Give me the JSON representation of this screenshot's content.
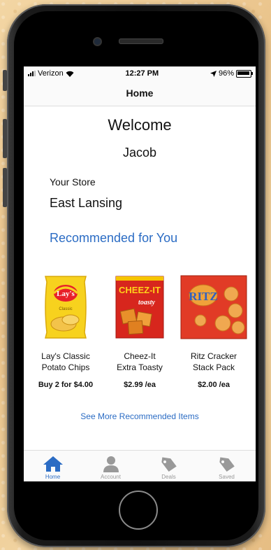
{
  "status_bar": {
    "carrier": "Verizon",
    "time": "12:27 PM",
    "battery": "96%"
  },
  "nav": {
    "title": "Home"
  },
  "home": {
    "welcome": "Welcome",
    "user_name": "Jacob",
    "store_label": "Your Store",
    "store_name": "East Lansing",
    "recommended_title": "Recommended for You",
    "see_more": "See More Recommended Items"
  },
  "products": [
    {
      "name_line1": "Lay's Classic",
      "name_line2": "Potato Chips",
      "price": "Buy 2 for $4.00",
      "image_icon": "chips-bag-icon",
      "brand_text": "Lay's",
      "sub_text": "Classic"
    },
    {
      "name_line1": "Cheez-It",
      "name_line2": "Extra Toasty",
      "price": "$2.99 /ea",
      "image_icon": "cracker-box-icon",
      "brand_text": "CHEEZ-IT",
      "sub_text": "toasty"
    },
    {
      "name_line1": "Ritz Cracker",
      "name_line2": "Stack Pack",
      "price": "$2.00 /ea",
      "image_icon": "cracker-box-icon",
      "brand_text": "RITZ"
    }
  ],
  "tabs": [
    {
      "label": "Home",
      "icon": "house-icon",
      "active": true
    },
    {
      "label": "Account",
      "icon": "person-icon",
      "active": false
    },
    {
      "label": "Deals",
      "icon": "tag-icon",
      "active": false
    },
    {
      "label": "Saved",
      "icon": "tag-icon",
      "active": false
    }
  ],
  "colors": {
    "accent": "#2b6cc4",
    "inactive_tab": "#999999",
    "background": "#ffffff"
  }
}
